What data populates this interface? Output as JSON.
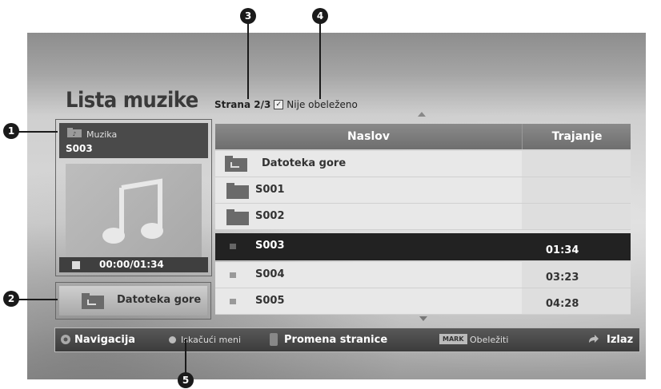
{
  "title": "Lista muzike",
  "page_info": {
    "page": "Strana 2/3",
    "mark_status": "Nije obeleženo"
  },
  "info_panel": {
    "category": "Muzika",
    "file": "S003",
    "time": "00:00/01:34"
  },
  "up_button": {
    "label": "Datoteka gore"
  },
  "list": {
    "columns": [
      "Naslov",
      "Trajanje"
    ],
    "rows": [
      {
        "name": "Datoteka gore",
        "duration": "",
        "icon": "folder-up-icon"
      },
      {
        "name": "S001",
        "duration": "",
        "icon": "folder-icon"
      },
      {
        "name": "S002",
        "duration": "",
        "icon": "folder-icon"
      },
      {
        "name": "S003",
        "duration": "01:34",
        "icon": "music-file-icon",
        "selected": true
      },
      {
        "name": "S004",
        "duration": "03:23",
        "icon": "music-file-icon"
      },
      {
        "name": "S005",
        "duration": "04:28",
        "icon": "music-file-icon"
      }
    ]
  },
  "bottom_bar": {
    "navigation": "Navigacija",
    "popup_menu": "Iskačući meni",
    "page_change": "Promena stranice",
    "mark_key": "MARK",
    "mark": "Obeležiti",
    "exit": "Izlaz"
  },
  "callouts": [
    "1",
    "2",
    "3",
    "4",
    "5"
  ]
}
